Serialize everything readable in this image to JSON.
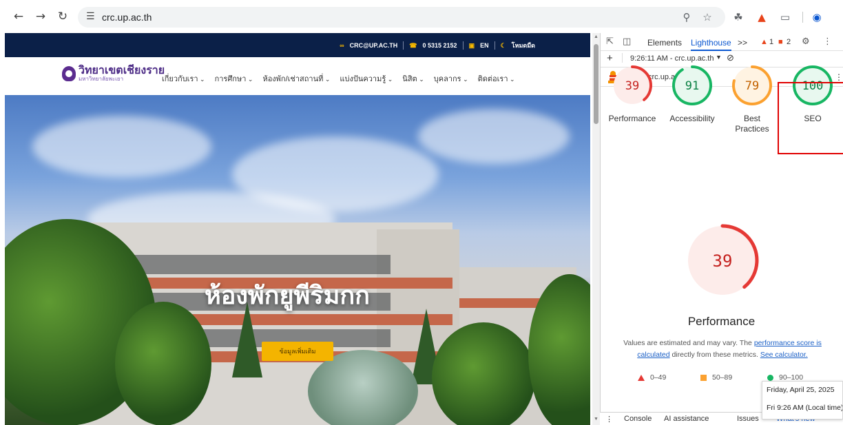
{
  "browser": {
    "url": "crc.up.ac.th",
    "icons": [
      "back-arrow-icon",
      "forward-arrow-icon",
      "reload-icon",
      "site-settings-icon",
      "zoom-icon",
      "bookmark-star-icon",
      "bug-extension-icon",
      "lighthouse-extension-icon",
      "extensions-puzzle-icon",
      "profile-icon"
    ]
  },
  "site": {
    "topbar": {
      "email": "CRC@UP.AC.TH",
      "phone": "0 5315 2152",
      "language": "EN",
      "dark_mode": "โหมดมืด"
    },
    "logo": {
      "line1": "วิทยาเขตเชียงราย",
      "line2": "มหาวิทยาลัยพะเยา"
    },
    "menu": [
      "เกี่ยวกับเรา",
      "การศึกษา",
      "ห้องพัก/เช่าสถานที่",
      "แบ่งปันความรู้",
      "นิสิต",
      "บุคลากร",
      "ติดต่อเรา"
    ],
    "hero": {
      "title": "ห้องพักยูพีริมกก",
      "button": "ข้อมูลเพิ่มเติม"
    }
  },
  "devtools": {
    "tabs": [
      "Elements",
      "Lighthouse"
    ],
    "active_tab": "Lighthouse",
    "more_tabs": ">>",
    "warnings": "1",
    "issues": "2",
    "report_time": "9:26:11 AM - crc.up.ac.th",
    "audited_url": "https://crc.up.ac.th/",
    "scores": [
      {
        "label": "Performance",
        "value": 39,
        "color": "#e53935"
      },
      {
        "label": "Accessibility",
        "value": 91,
        "color": "#18b663"
      },
      {
        "label": "Best Practices",
        "value": 79,
        "color": "#fba130"
      },
      {
        "label": "SEO",
        "value": 100,
        "color": "#18b663"
      }
    ],
    "main_gauge": {
      "value": 39,
      "label": "Performance",
      "color": "#e53935"
    },
    "description": {
      "text1": "Values are estimated and may vary. The ",
      "link1": "performance score is calculated",
      "text2": " directly from these metrics. ",
      "link2": "See calculator."
    },
    "legend": [
      "0–49",
      "50–89",
      "90–100"
    ],
    "tooltip": {
      "line1": "Friday, April 25, 2025",
      "line2": "Fri 9:26 AM (Local time)"
    },
    "drawer_tabs": [
      "Console",
      "AI assistance",
      "Issues",
      "What's new"
    ]
  }
}
